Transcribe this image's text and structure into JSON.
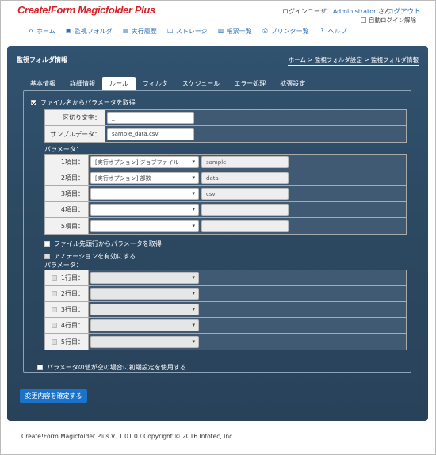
{
  "app": {
    "logo": "Create!Form Magicfolder Plus"
  },
  "user": {
    "label": "ログインユーザ：",
    "name": "Administrator",
    "suffix": " さん",
    "logout": "ログアウト",
    "auto_logout": "自動ログイン解除"
  },
  "nav": [
    {
      "label": "ホーム",
      "icon": "home-icon",
      "glyph": "⌂"
    },
    {
      "label": "監視フォルダ",
      "icon": "folder-icon",
      "glyph": "▣"
    },
    {
      "label": "実行履歴",
      "icon": "history-icon",
      "glyph": "▤"
    },
    {
      "label": "ストレージ",
      "icon": "storage-icon",
      "glyph": "◫"
    },
    {
      "label": "帳票一覧",
      "icon": "list-icon",
      "glyph": "▥"
    },
    {
      "label": "プリンター覧",
      "icon": "printer-icon",
      "glyph": "⎙"
    },
    {
      "label": "ヘルプ",
      "icon": "help-icon",
      "glyph": "?"
    }
  ],
  "panel": {
    "title": "監視フォルダ情報"
  },
  "breadcrumb": {
    "home": "ホーム",
    "sep": " > ",
    "settings": "監視フォルダ設定",
    "current": "監視フォルダ情報"
  },
  "tabs": [
    "基本情報",
    "詳細情報",
    "ルール",
    "フィルタ",
    "スケジュール",
    "エラー処理",
    "拡張設定"
  ],
  "active_tab": "ルール",
  "filename_params": {
    "checkbox_label": "ファイル名からパラメータを取得",
    "separator_label": "区切り文字：",
    "separator_value": "_",
    "sample_label": "サンプルデータ：",
    "sample_value": "sample_data.csv",
    "params_label": "パラメータ：",
    "items": [
      {
        "label": "1項目：",
        "select": "[実行オプション] ジョブファイル",
        "value": "sample"
      },
      {
        "label": "2項目：",
        "select": "[実行オプション] 部数",
        "value": "data"
      },
      {
        "label": "3項目：",
        "select": "",
        "value": "csv"
      },
      {
        "label": "4項目：",
        "select": "",
        "value": ""
      },
      {
        "label": "5項目：",
        "select": "",
        "value": ""
      }
    ]
  },
  "file_head_params": {
    "checkbox_label": "ファイル先頭行からパラメータを取得",
    "annotation_label": "アノテーションを有効にする",
    "params_label": "パラメータ：",
    "rows": [
      "1行目：",
      "2行目：",
      "3行目：",
      "4行目：",
      "5行目："
    ]
  },
  "empty_default_label": "パラメータの値が空の場合に初期設定を使用する",
  "confirm_button": "変更内容を確定する",
  "footer": "Create!Form Magicfolder Plus V11.01.0 / Copyright © 2016 Infotec, Inc."
}
